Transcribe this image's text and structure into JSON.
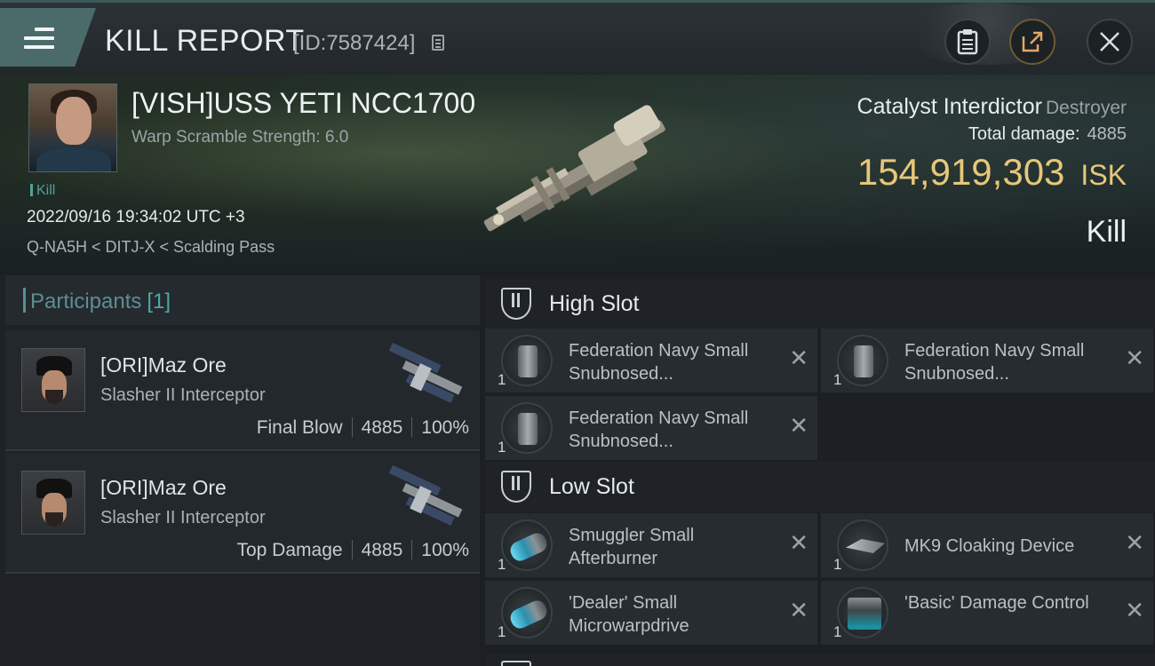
{
  "header": {
    "title": "KILL REPORT",
    "report_id": "[ID:7587424]"
  },
  "victim": {
    "name": "[VISH]USS YETI NCC1700",
    "warp_scramble": "Warp Scramble Strength: 6.0",
    "kill_tag": "Kill",
    "datetime": "2022/09/16 19:34:02 UTC +3",
    "location": "Q-NA5H < DITJ-X < Scalding Pass",
    "ship_name": "Catalyst Interdictor",
    "ship_class": "Destroyer",
    "total_damage_label": "Total damage:",
    "total_damage": "4885",
    "isk_value": "154,919,303",
    "isk_unit": "ISK",
    "result": "Kill"
  },
  "participants": {
    "label": "Participants",
    "count": "[1]",
    "rows": [
      {
        "name": "[ORI]Maz Ore",
        "ship": "Slasher II Interceptor",
        "role": "Final Blow",
        "damage": "4885",
        "percent": "100%"
      },
      {
        "name": "[ORI]Maz Ore",
        "ship": "Slasher II Interceptor",
        "role": "Top Damage",
        "damage": "4885",
        "percent": "100%"
      }
    ]
  },
  "slots": {
    "high": {
      "title": "High Slot",
      "modules": [
        {
          "name": "Federation Navy Small Snubnosed...",
          "qty": "1",
          "icon": "hybrid-turret-icon"
        },
        {
          "name": "Federation Navy Small Snubnosed...",
          "qty": "1",
          "icon": "hybrid-turret-icon"
        },
        {
          "name": "Federation Navy Small Snubnosed...",
          "qty": "1",
          "icon": "hybrid-turret-icon"
        }
      ]
    },
    "low": {
      "title": "Low Slot",
      "modules": [
        {
          "name": "Smuggler Small Afterburner",
          "qty": "1",
          "icon": "afterburner-icon"
        },
        {
          "name": "MK9 Cloaking Device",
          "qty": "1",
          "icon": "cloaking-device-icon"
        },
        {
          "name": "'Dealer' Small Microwarpdrive",
          "qty": "1",
          "icon": "microwarpdrive-icon"
        },
        {
          "name": "'Basic' Damage Control",
          "qty": "1",
          "icon": "damage-control-icon"
        }
      ]
    }
  },
  "colors": {
    "accent_teal": "#4fa2a0",
    "isk_gold": "#e6c77a",
    "menu_tab": "#4b6a6a"
  }
}
